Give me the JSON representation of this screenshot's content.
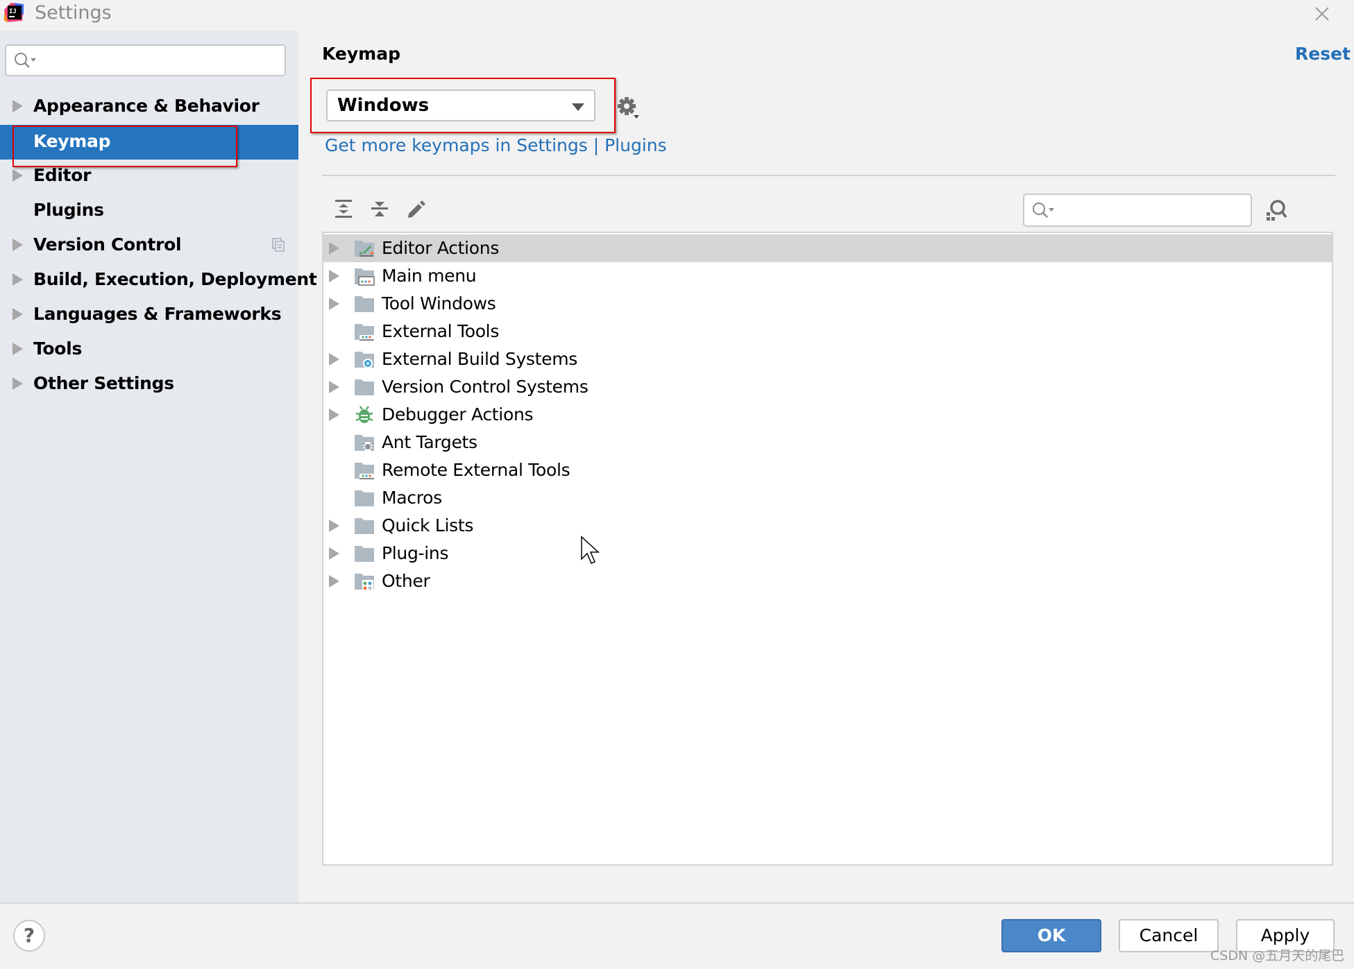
{
  "window": {
    "title": "Settings",
    "app_icon": "intellij-idea-logo-icon",
    "close_icon": "close-icon"
  },
  "sidebar": {
    "search": {
      "value": "",
      "placeholder": "",
      "icon": "search-icon"
    },
    "items": [
      {
        "label": "Appearance & Behavior",
        "expandable": true,
        "selected": false
      },
      {
        "label": "Keymap",
        "expandable": false,
        "selected": true,
        "highlighted": true
      },
      {
        "label": "Editor",
        "expandable": true,
        "selected": false
      },
      {
        "label": "Plugins",
        "expandable": false,
        "selected": false
      },
      {
        "label": "Version Control",
        "expandable": true,
        "selected": false,
        "badge_icon": "project-settings-copy-icon"
      },
      {
        "label": "Build, Execution, Deployment",
        "expandable": true,
        "selected": false
      },
      {
        "label": "Languages & Frameworks",
        "expandable": true,
        "selected": false
      },
      {
        "label": "Tools",
        "expandable": true,
        "selected": false
      },
      {
        "label": "Other Settings",
        "expandable": true,
        "selected": false
      }
    ]
  },
  "main": {
    "title": "Keymap",
    "reset_label": "Reset",
    "keymap_select": {
      "value": "Windows",
      "highlighted": true
    },
    "gear_icon": "gear-icon",
    "plugins_link": "Get more keymaps in Settings | Plugins",
    "toolbar": {
      "expand_all_icon": "expand-all-icon",
      "collapse_all_icon": "collapse-all-icon",
      "edit_icon": "pencil-icon",
      "search": {
        "value": "",
        "placeholder": "",
        "icon": "search-icon"
      },
      "find_by_shortcut_icon": "find-by-shortcut-icon"
    },
    "tree": [
      {
        "label": "Editor Actions",
        "icon": "folder-editor-actions-icon",
        "expandable": true,
        "selected": true
      },
      {
        "label": "Main menu",
        "icon": "folder-menu-icon",
        "expandable": true,
        "selected": false
      },
      {
        "label": "Tool Windows",
        "icon": "folder-icon",
        "expandable": true,
        "selected": false
      },
      {
        "label": "External Tools",
        "icon": "folder-external-tools-icon",
        "expandable": false,
        "selected": false
      },
      {
        "label": "External Build Systems",
        "icon": "folder-gear-icon",
        "expandable": true,
        "selected": false
      },
      {
        "label": "Version Control Systems",
        "icon": "folder-icon",
        "expandable": true,
        "selected": false
      },
      {
        "label": "Debugger Actions",
        "icon": "bug-icon",
        "expandable": true,
        "selected": false
      },
      {
        "label": "Ant Targets",
        "icon": "folder-ant-icon",
        "expandable": false,
        "selected": false
      },
      {
        "label": "Remote External Tools",
        "icon": "folder-external-tools-icon",
        "expandable": false,
        "selected": false
      },
      {
        "label": "Macros",
        "icon": "folder-icon",
        "expandable": false,
        "selected": false
      },
      {
        "label": "Quick Lists",
        "icon": "folder-icon",
        "expandable": true,
        "selected": false
      },
      {
        "label": "Plug-ins",
        "icon": "folder-icon",
        "expandable": true,
        "selected": false
      },
      {
        "label": "Other",
        "icon": "folder-other-icon",
        "expandable": true,
        "selected": false
      }
    ]
  },
  "footer": {
    "help_label": "?",
    "ok_label": "OK",
    "cancel_label": "Cancel",
    "apply_label": "Apply"
  },
  "watermark": "CSDN @五月天的尾巴",
  "colors": {
    "accent": "#2675bf",
    "link": "#2470b8",
    "highlight_box": "#e00000",
    "ok_button": "#4a88c9",
    "sidebar_bg": "#e6eaef",
    "selected_tree_row": "#d5d5d5"
  }
}
